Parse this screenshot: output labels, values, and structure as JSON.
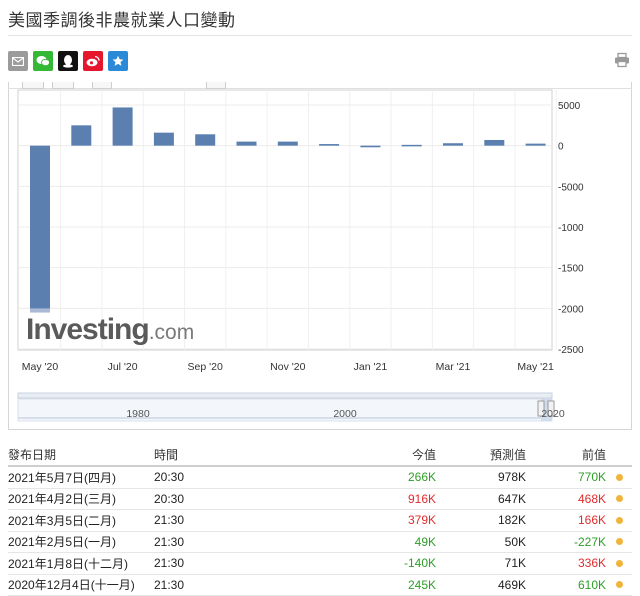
{
  "title": "美國季調後非農就業人口變動",
  "share": [
    {
      "name": "email-share-icon",
      "color": "#9b9b9b"
    },
    {
      "name": "wechat-share-icon",
      "color": "#35b835"
    },
    {
      "name": "qq-share-icon",
      "color": "#111111"
    },
    {
      "name": "weibo-share-icon",
      "color": "#e6162d"
    },
    {
      "name": "favorite-share-icon",
      "color": "#2a8ad8"
    }
  ],
  "logo": {
    "brand": "Investing",
    "domain": ".com"
  },
  "chart_data": {
    "type": "bar",
    "categories": [
      "May '20",
      "Jun '20",
      "Jul '20",
      "Aug '20",
      "Sep '20",
      "Oct '20",
      "Nov '20",
      "Dec '20",
      "Jan '21",
      "Feb '21",
      "Mar '21",
      "Apr '21",
      "May '21"
    ],
    "x_tick_labels": [
      "May '20",
      "Jul '20",
      "Sep '20",
      "Nov '20",
      "Jan '21",
      "Mar '21",
      "May '21"
    ],
    "values": [
      -20500,
      2500,
      4700,
      1600,
      1400,
      500,
      500,
      200,
      -200,
      100,
      300,
      700,
      250
    ],
    "ylim": [
      -25000,
      5000
    ],
    "y_ticks": [
      5000,
      0,
      -5000,
      -10000,
      -15000,
      -20000,
      -25000
    ],
    "y_tick_labels": [
      "5000",
      "0",
      "-5000",
      "-1000",
      "-1500",
      "-2000",
      "-2500"
    ],
    "bar_color": "#5b80b0",
    "grid": true,
    "navigator_labels": [
      "1980",
      "2000",
      "2020"
    ]
  },
  "table": {
    "headers": {
      "date": "發布日期",
      "time": "時間",
      "actual": "今值",
      "forecast": "預測值",
      "previous": "前值"
    },
    "rows": [
      {
        "date": "2021年5月7日(四月)",
        "time": "20:30",
        "actual": "266K",
        "actual_color": "green",
        "forecast": "978K",
        "previous": "770K",
        "previous_color": "green"
      },
      {
        "date": "2021年4月2日(三月)",
        "time": "20:30",
        "actual": "916K",
        "actual_color": "red",
        "forecast": "647K",
        "previous": "468K",
        "previous_color": "red"
      },
      {
        "date": "2021年3月5日(二月)",
        "time": "21:30",
        "actual": "379K",
        "actual_color": "red",
        "forecast": "182K",
        "previous": "166K",
        "previous_color": "red"
      },
      {
        "date": "2021年2月5日(一月)",
        "time": "21:30",
        "actual": "49K",
        "actual_color": "green",
        "forecast": "50K",
        "previous": "-227K",
        "previous_color": "green"
      },
      {
        "date": "2021年1月8日(十二月)",
        "time": "21:30",
        "actual": "-140K",
        "actual_color": "green",
        "forecast": "71K",
        "previous": "336K",
        "previous_color": "red"
      },
      {
        "date": "2020年12月4日(十一月)",
        "time": "21:30",
        "actual": "245K",
        "actual_color": "green",
        "forecast": "469K",
        "previous": "610K",
        "previous_color": "green"
      }
    ]
  }
}
